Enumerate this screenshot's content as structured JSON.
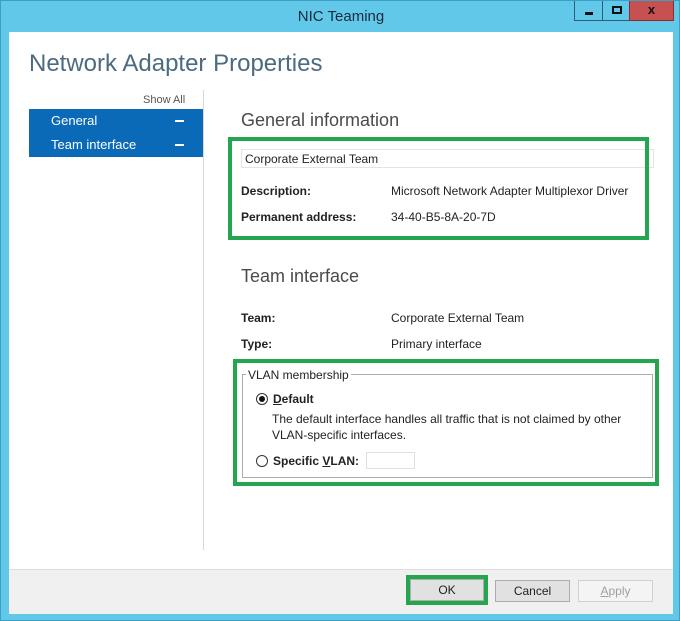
{
  "window": {
    "title": "NIC Teaming",
    "controls": {
      "minimize": "minimize",
      "maximize": "maximize",
      "close": "x"
    }
  },
  "page": {
    "title": "Network Adapter Properties"
  },
  "sidebar": {
    "show_all": "Show All",
    "items": [
      {
        "label": "General"
      },
      {
        "label": "Team interface"
      }
    ]
  },
  "general": {
    "heading": "General information",
    "name_value": "Corporate External Team",
    "description_label": "Description:",
    "description_value": "Microsoft Network Adapter Multiplexor Driver",
    "address_label": "Permanent address:",
    "address_value": "34-40-B5-8A-20-7D"
  },
  "team_interface": {
    "heading": "Team interface",
    "team_label": "Team:",
    "team_value": "Corporate External Team",
    "type_label": "Type:",
    "type_value": "Primary interface"
  },
  "vlan": {
    "legend": "VLAN membership",
    "default_label_mnemonic": "D",
    "default_label_rest": "efault",
    "default_selected": true,
    "default_description": "The default interface handles all traffic that is not claimed by other VLAN-specific interfaces.",
    "specific_label_pre": "Specific ",
    "specific_label_mnemonic": "V",
    "specific_label_post": "LAN:",
    "specific_selected": false,
    "specific_value": ""
  },
  "footer": {
    "ok": "OK",
    "cancel": "Cancel",
    "apply_mnemonic": "A",
    "apply_rest": "pply"
  },
  "colors": {
    "highlight": "#26a550",
    "nav_bg": "#0a6ab8",
    "titlebar": "#62c8ea",
    "close": "#c75050"
  }
}
